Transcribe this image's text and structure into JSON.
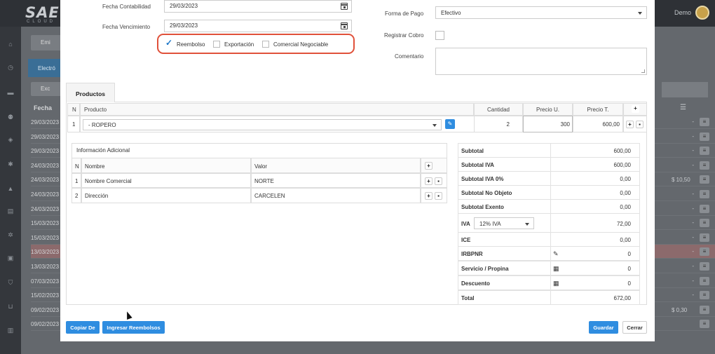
{
  "background": {
    "logo": "SAE",
    "logo_sub": "CLOUD",
    "user": "Demo",
    "emit_label": "Emi",
    "tab_label": "Electró",
    "export_label": "Exc",
    "fecha_header": "Fecha",
    "rows": [
      "29/03/2023",
      "29/03/2023",
      "29/03/2023",
      "24/03/2023",
      "24/03/2023",
      "24/03/2023",
      "24/03/2023",
      "15/03/2023",
      "15/03/2023",
      "13/03/2023",
      "13/03/2023",
      "07/03/2023",
      "15/02/2023",
      "09/02/2023",
      "09/02/2023"
    ],
    "right_amounts": {
      "r4": "$ 10,50",
      "r13": "$ 0,30"
    }
  },
  "form": {
    "fecha_contabilidad_label": "Fecha Contabilidad",
    "fecha_contabilidad": "29/03/2023",
    "fecha_vencimiento_label": "Fecha Vencimiento",
    "fecha_vencimiento": "29/03/2023",
    "checks": {
      "reembolso": "Reembolso",
      "exportacion": "Exportación",
      "comercial": "Comercial Negociable"
    },
    "forma_pago_label": "Forma de Pago",
    "forma_pago": "Efectivo",
    "registrar_cobro_label": "Registrar Cobro",
    "comentario_label": "Comentario"
  },
  "products": {
    "tab": "Productos",
    "headers": {
      "n": "N",
      "producto": "Producto",
      "cantidad": "Cantidad",
      "precio_u": "Precio U.",
      "precio_t": "Precio T."
    },
    "row": {
      "n": "1",
      "producto": "- ROPERO",
      "cantidad": "2",
      "precio_u": "300",
      "precio_t": "600,00"
    }
  },
  "info": {
    "title": "Información Adicional",
    "headers": {
      "n": "N",
      "nombre": "Nombre",
      "valor": "Valor"
    },
    "rows": [
      {
        "n": "1",
        "nombre": "Nombre Comercial",
        "valor": "NORTE"
      },
      {
        "n": "2",
        "nombre": "Dirección",
        "valor": "CARCELEN"
      }
    ]
  },
  "totals": {
    "subtotal_label": "Subtotal",
    "subtotal": "600,00",
    "subtotal_iva_label": "Subtotal IVA",
    "subtotal_iva": "600,00",
    "subtotal_iva0_label": "Subtotal IVA 0%",
    "subtotal_iva0": "0,00",
    "no_objeto_label": "Subtotal No Objeto",
    "no_objeto": "0,00",
    "exento_label": "Subtotal Exento",
    "exento": "0,00",
    "iva_label": "IVA",
    "iva_select": "12% IVA",
    "iva": "72,00",
    "ice_label": "ICE",
    "ice": "0,00",
    "irbpnr_label": "IRBPNR",
    "irbpnr": "0",
    "servicio_label": "Servicio / Propina",
    "servicio": "0",
    "descuento_label": "Descuento",
    "descuento": "0",
    "total_label": "Total",
    "total": "672,00"
  },
  "footer": {
    "copiar": "Copiar De",
    "ingresar": "Ingresar Reembolsos",
    "guardar": "Guardar",
    "cerrar": "Cerrar"
  },
  "colors": {
    "accent": "#2f8de0",
    "highlight": "#e0513a"
  }
}
